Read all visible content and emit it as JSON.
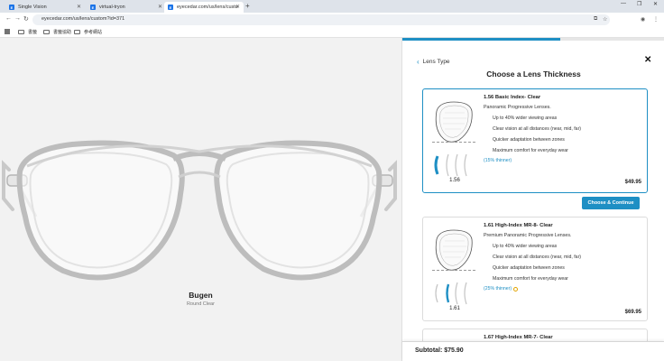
{
  "browser": {
    "tabs": [
      {
        "label": "Single Vision",
        "favicon": "E"
      },
      {
        "label": "virtual-tryon",
        "favicon": "E"
      },
      {
        "label": "eyecedar.com/us/lens/custo",
        "favicon": "E"
      }
    ],
    "new_tab": "+",
    "url": "eyecedar.com/us/lens/custom?id=371",
    "bookmarks": [
      "書籤",
      "書籤協助",
      "参考網站"
    ]
  },
  "product": {
    "name": "Bugen",
    "subtitle": "Round Clear"
  },
  "panel": {
    "back_label": "Lens Type",
    "close_label": "✕",
    "title": "Choose a Lens Thickness",
    "progress": 0.6,
    "accent_color": "#1e8fc4",
    "continue_label": "Choose & Continue",
    "subtotal": "Subtotal: $75.90",
    "options": [
      {
        "title": "1.56 Basic Index- Clear",
        "subtitle": "Panoramic Progressive Lenses.",
        "features": [
          "Up to 40% wider viewing areas",
          "Clear vision at all distances (near, mid, far)",
          "Quicker adaptation between zones",
          "Maximum comfort for everyday wear"
        ],
        "thinner": "(15% thinner)",
        "thickness": "1.56",
        "price": "$49.95",
        "selected": true
      },
      {
        "title": "1.61 High-Index MR-8- Clear",
        "subtitle": "Premium Panoramic Progressive Lenses.",
        "features": [
          "Up to 40% wider viewing areas",
          "Clear vision at all distances (near, mid, far)",
          "Quicker adaptation between zones",
          "Maximum comfort for everyday wear"
        ],
        "thinner": "(25% thinner)",
        "thickness": "1.61",
        "price": "$69.95",
        "selected": false
      },
      {
        "title": "1.67 High-Index MR-7- Clear",
        "selected": false
      }
    ]
  }
}
